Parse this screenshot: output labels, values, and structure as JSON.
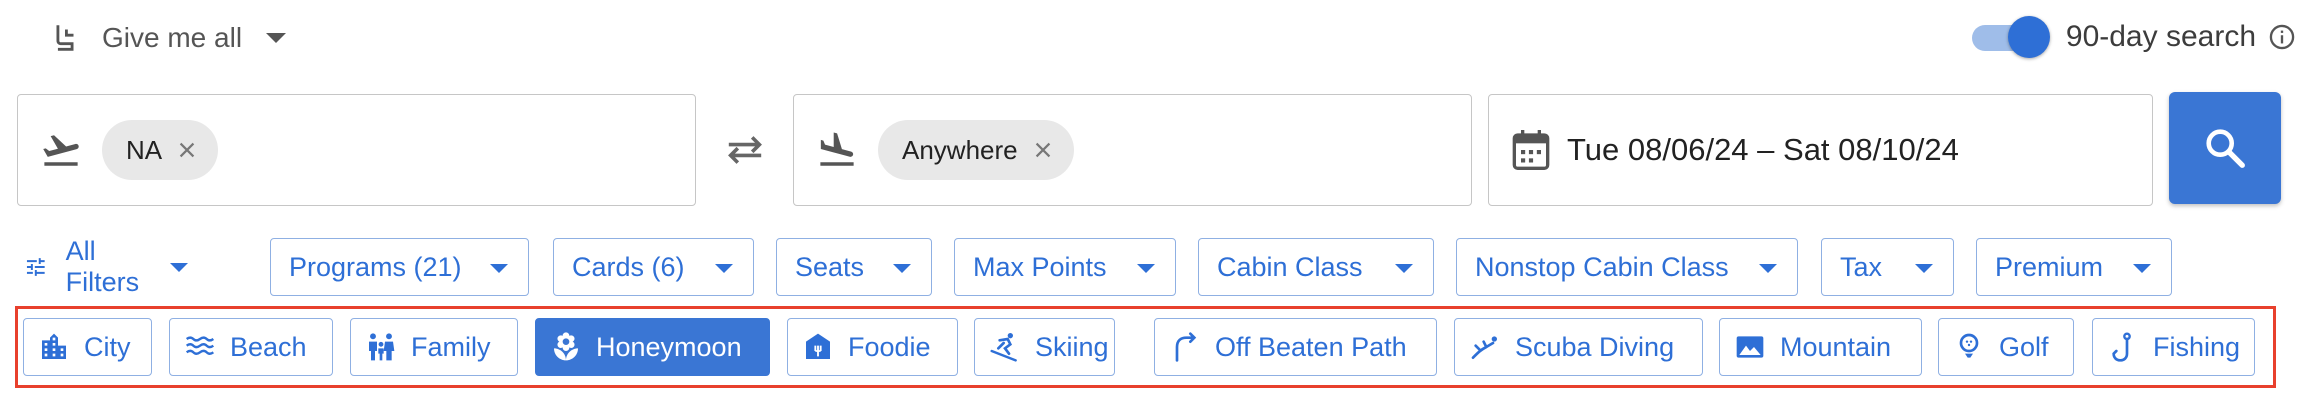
{
  "header": {
    "cabin_selector": {
      "label": "Give me all",
      "icon": "seat-icon"
    },
    "search_toggle": {
      "label": "90-day search",
      "enabled": true,
      "icon": "info-icon"
    }
  },
  "search": {
    "origin": {
      "icon": "takeoff-icon",
      "chip": "NA"
    },
    "destination": {
      "icon": "landing-icon",
      "chip": "Anywhere"
    },
    "swap_icon": "swap-arrows-icon",
    "dates": {
      "icon": "calendar-icon",
      "value": "Tue 08/06/24 – Sat 08/10/24"
    },
    "submit_icon": "search-icon"
  },
  "filters": {
    "all_filters": "All Filters",
    "items": [
      "Programs (21)",
      "Cards (6)",
      "Seats",
      "Max Points",
      "Cabin Class",
      "Nonstop Cabin Class",
      "Tax",
      "Premium"
    ]
  },
  "categories": {
    "active": "Honeymoon",
    "items": [
      "City",
      "Beach",
      "Family",
      "Honeymoon",
      "Foodie",
      "Skiing",
      "Off Beaten Path",
      "Scuba Diving",
      "Mountain",
      "Golf",
      "Fishing"
    ],
    "icons": [
      "city-icon",
      "waves-icon",
      "family-icon",
      "flower-icon",
      "food-store-icon",
      "skier-icon",
      "detour-arrow-icon",
      "scuba-icon",
      "landscape-icon",
      "golf-icon",
      "fishing-hook-icon"
    ]
  },
  "colors": {
    "accent": "#3a76d4",
    "highlight_frame": "#e8402d",
    "chip_bg": "#e8e8e8"
  }
}
